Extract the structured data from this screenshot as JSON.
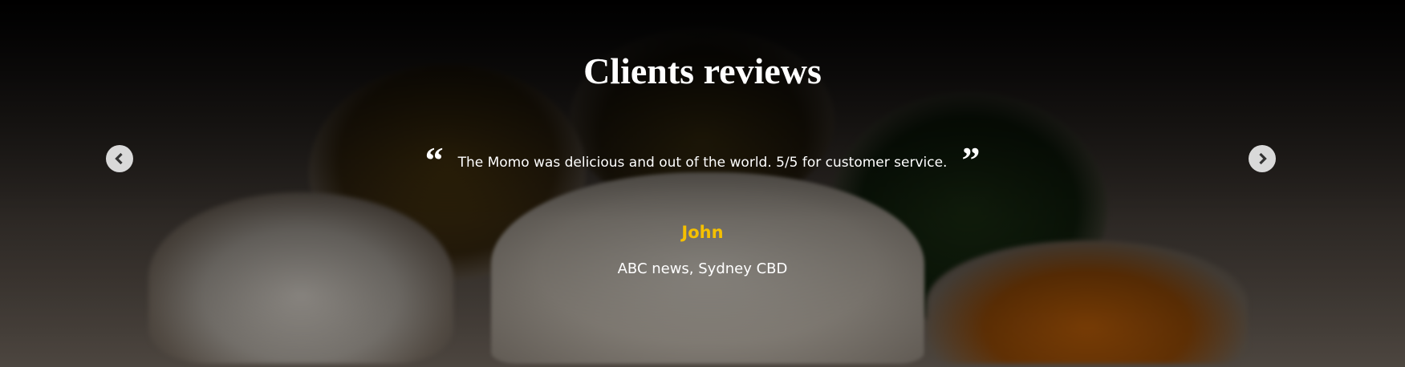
{
  "section": {
    "title": "Clients reviews",
    "prev_icon": "chevron-left-icon",
    "next_icon": "chevron-right-icon"
  },
  "review": {
    "open_quote": "“",
    "close_quote": "”",
    "text": "The Momo was delicious and out of the world. 5/5 for customer service.",
    "name": "John",
    "affiliation": "ABC news, Sydney CBD"
  },
  "colors": {
    "name_accent": "#f5c000",
    "text": "#ffffff",
    "arrow_bg": "#d9d9d9"
  }
}
